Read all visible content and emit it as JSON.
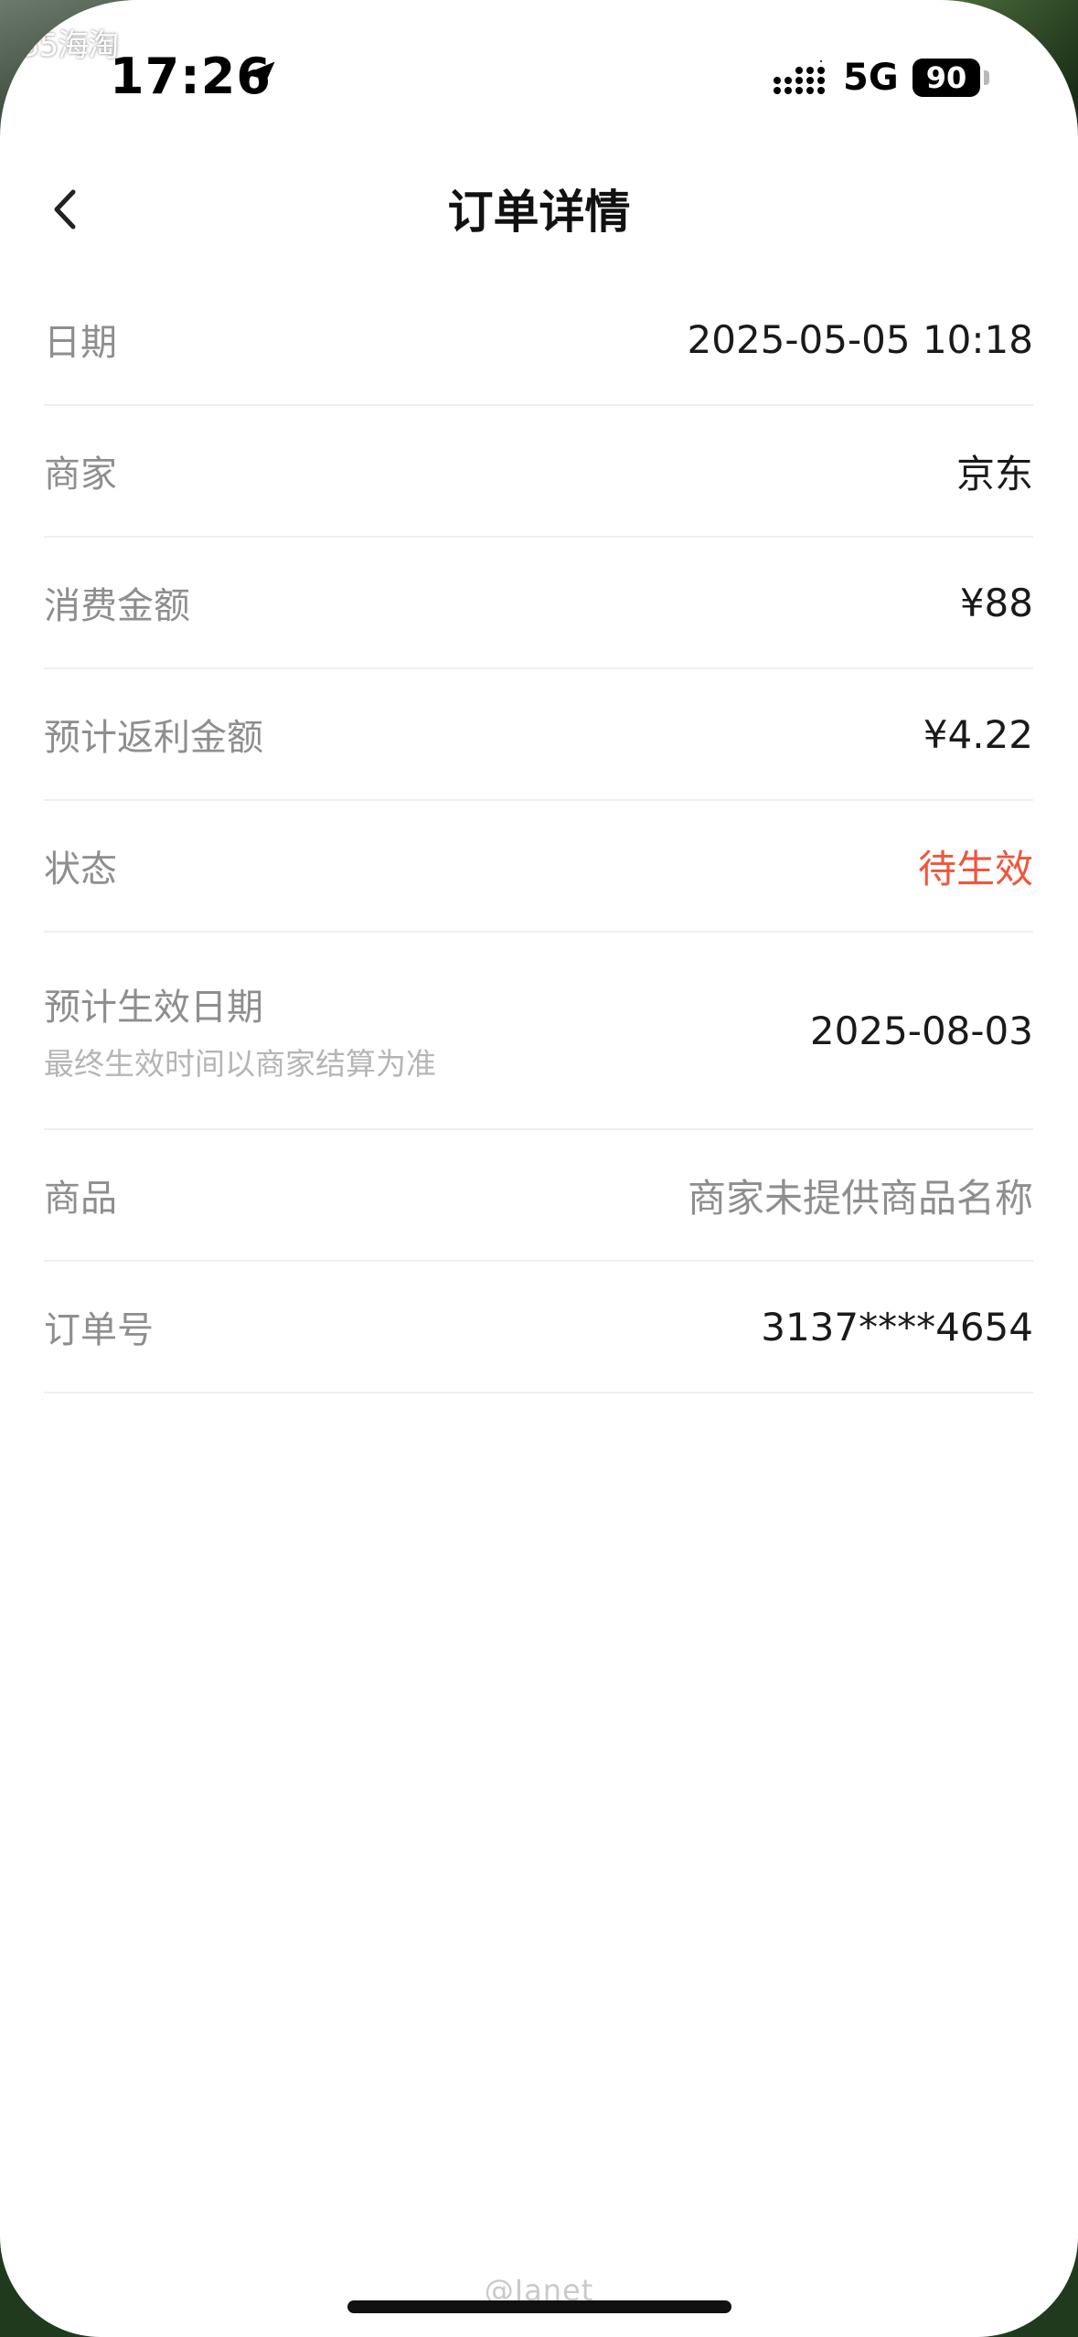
{
  "watermark_top": "55海淘",
  "status_bar": {
    "time": "17:26",
    "network": "5G",
    "battery_level": "90",
    "icons": [
      "location-arrow-icon",
      "cellular-signal-icon",
      "battery-icon"
    ]
  },
  "nav": {
    "title": "订单详情",
    "back_icon": "chevron-left-icon"
  },
  "details": {
    "date": {
      "label": "日期",
      "value": "2025-05-05 10:18"
    },
    "merchant": {
      "label": "商家",
      "value": "京东"
    },
    "amount": {
      "label": "消费金额",
      "value": "¥88"
    },
    "rebate": {
      "label": "预计返利金额",
      "value": "¥4.22"
    },
    "status": {
      "label": "状态",
      "value": "待生效"
    },
    "effective_date": {
      "label": "预计生效日期",
      "sublabel": "最终生效时间以商家结算为准",
      "value": "2025-08-03"
    },
    "product": {
      "label": "商品",
      "value": "商家未提供商品名称"
    },
    "order_no": {
      "label": "订单号",
      "value": "3137****4654"
    }
  },
  "colors": {
    "status_pending": "#f0553b",
    "label_gray": "#8e8e8e",
    "divider": "#efefef"
  },
  "watermark_bottom": "@Janet"
}
